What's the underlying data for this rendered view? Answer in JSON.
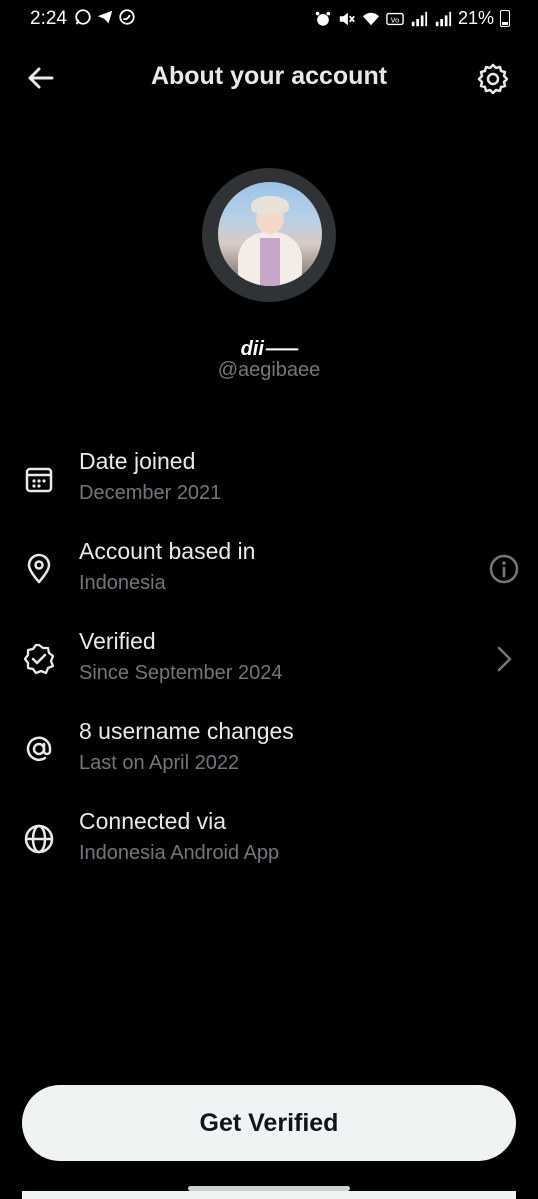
{
  "status_bar": {
    "time": "2:24",
    "battery": "21%",
    "battery_level": 0.21
  },
  "header": {
    "title": "About your account",
    "back_icon": "arrow-left-icon",
    "settings_icon": "gear-icon"
  },
  "profile": {
    "display_name": "dii⸺",
    "handle": "@aegibaee"
  },
  "info_rows": [
    {
      "icon": "calendar-icon",
      "title": "Date joined",
      "subtitle": "December 2021"
    },
    {
      "icon": "location-pin-icon",
      "title": "Account based in",
      "subtitle": "Indonesia",
      "action_icon": "info-icon"
    },
    {
      "icon": "verified-badge-icon",
      "title": "Verified",
      "subtitle": "Since September 2024",
      "action_icon": "chevron-right-icon"
    },
    {
      "icon": "at-sign-icon",
      "title": "8 username changes",
      "subtitle": "Last on April 2022"
    },
    {
      "icon": "globe-icon",
      "title": "Connected via",
      "subtitle": "Indonesia Android App"
    }
  ],
  "footer": {
    "button_label": "Get Verified"
  },
  "colors": {
    "background": "#000000",
    "primary_text": "#e7e9ea",
    "secondary_text": "#71767b",
    "button_bg": "#eff3f4",
    "button_text": "#0f1419"
  }
}
